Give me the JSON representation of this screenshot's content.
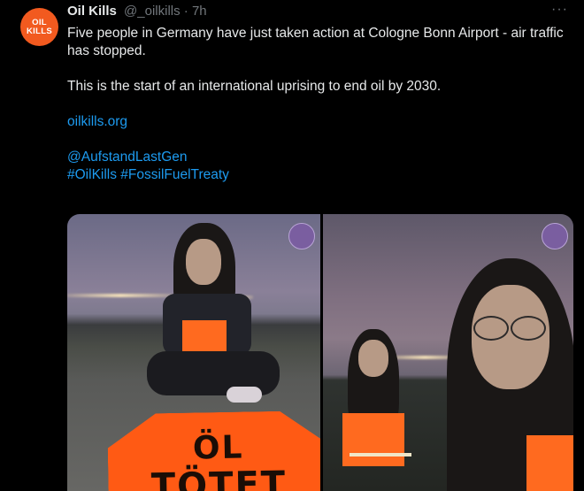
{
  "tweet": {
    "avatar": {
      "line1": "OIL",
      "line2": "KILLS"
    },
    "author_name": "Oil Kills",
    "author_handle": "@_oilkills",
    "separator": "·",
    "time": "7h",
    "more_icon": "···",
    "text": {
      "line1": "Five people in Germany have just taken action at Cologne Bonn Airport - air traffic has stopped.",
      "line2": "This is the start of an international uprising to end oil by 2030.",
      "link": "oilkills.org",
      "mention": "@AufstandLastGen",
      "hashtag1": "#OilKills",
      "hashtag2": "#FossilFuelTreaty"
    },
    "media": {
      "photo1_sign_line1": "ÖL",
      "photo1_sign_line2": "TÖTET"
    }
  },
  "colors": {
    "background": "#000000",
    "text": "#e7e9ea",
    "muted": "#71767b",
    "link": "#1d9bf0",
    "brand": "#f25a1f",
    "vest": "#ff6a1f"
  }
}
